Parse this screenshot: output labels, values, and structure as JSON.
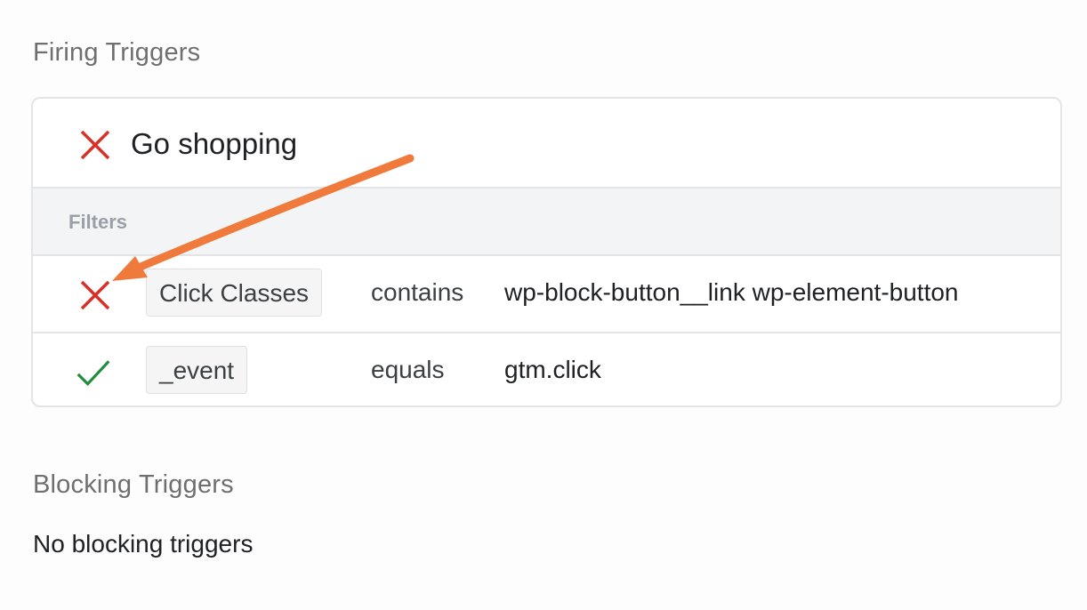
{
  "firing_section": {
    "title": "Firing Triggers",
    "trigger": {
      "name": "Go shopping",
      "status": "failed",
      "status_icon": "x-mark-icon"
    },
    "filters_label": "Filters",
    "filters": [
      {
        "status": "failed",
        "status_icon": "x-mark-icon",
        "variable": "Click Classes",
        "operator": "contains",
        "value": "wp-block-button__link wp-element-button"
      },
      {
        "status": "passed",
        "status_icon": "check-mark-icon",
        "variable": "_event",
        "operator": "equals",
        "value": "gtm.click"
      }
    ]
  },
  "blocking_section": {
    "title": "Blocking Triggers",
    "empty_text": "No blocking triggers"
  },
  "colors": {
    "fail": "#d93025",
    "pass": "#1e8e3e",
    "annotation_arrow": "#ef7a3c"
  }
}
